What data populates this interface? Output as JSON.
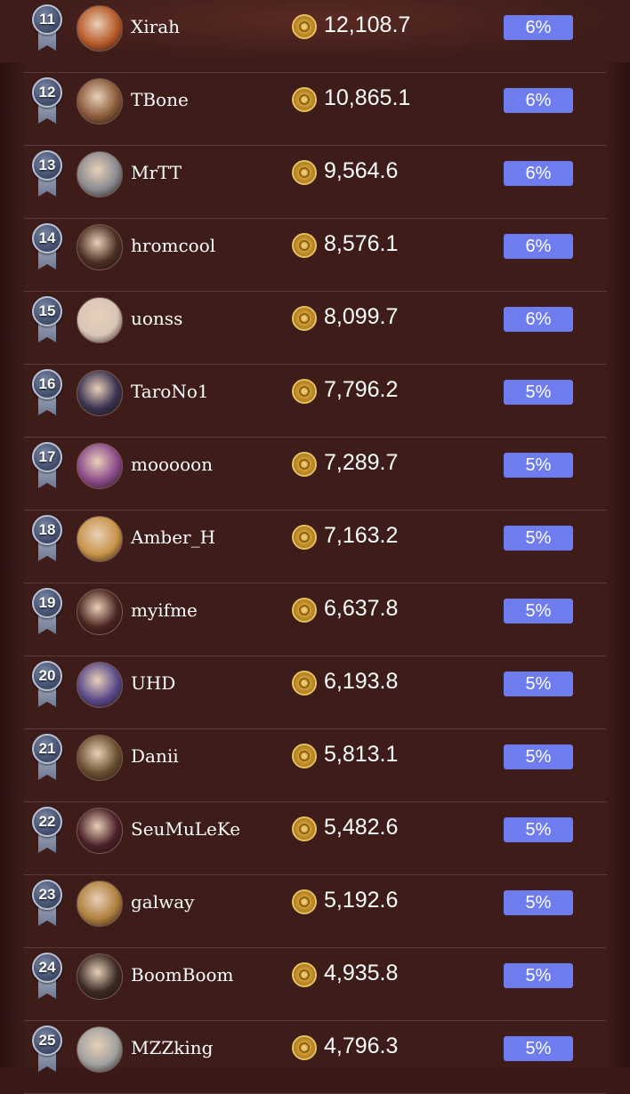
{
  "leaderboard": {
    "rows": [
      {
        "rank": "11",
        "name": "Xirah",
        "amount": "12,108.7",
        "percent": "6%",
        "avatar_color": "#b85a2a"
      },
      {
        "rank": "12",
        "name": "TBone",
        "amount": "10,865.1",
        "percent": "6%",
        "avatar_color": "#8a5a3a"
      },
      {
        "rank": "13",
        "name": "MrTT",
        "amount": "9,564.6",
        "percent": "6%",
        "avatar_color": "#8a8a90"
      },
      {
        "rank": "14",
        "name": "hromcool",
        "amount": "8,576.1",
        "percent": "6%",
        "avatar_color": "#4a2e24"
      },
      {
        "rank": "15",
        "name": "uonss",
        "amount": "8,099.7",
        "percent": "6%",
        "avatar_color": "#d8c6b8"
      },
      {
        "rank": "16",
        "name": "TaroNo1",
        "amount": "7,796.2",
        "percent": "5%",
        "avatar_color": "#3a3250"
      },
      {
        "rank": "17",
        "name": "mooooon",
        "amount": "7,289.7",
        "percent": "5%",
        "avatar_color": "#8a4a8a"
      },
      {
        "rank": "18",
        "name": "Amber_H",
        "amount": "7,163.2",
        "percent": "5%",
        "avatar_color": "#c8944a"
      },
      {
        "rank": "19",
        "name": "myifme",
        "amount": "6,637.8",
        "percent": "5%",
        "avatar_color": "#4a2420"
      },
      {
        "rank": "20",
        "name": "UHD",
        "amount": "6,193.8",
        "percent": "5%",
        "avatar_color": "#5a4a8a"
      },
      {
        "rank": "21",
        "name": "Danii",
        "amount": "5,813.1",
        "percent": "5%",
        "avatar_color": "#6a5030"
      },
      {
        "rank": "22",
        "name": "SeuMuLeKe",
        "amount": "5,482.6",
        "percent": "5%",
        "avatar_color": "#4a2028"
      },
      {
        "rank": "23",
        "name": "galway",
        "amount": "5,192.6",
        "percent": "5%",
        "avatar_color": "#b08040"
      },
      {
        "rank": "24",
        "name": "BoomBoom",
        "amount": "4,935.8",
        "percent": "5%",
        "avatar_color": "#3a2a24"
      },
      {
        "rank": "25",
        "name": "MZZking",
        "amount": "4,796.3",
        "percent": "5%",
        "avatar_color": "#a0a0a0"
      }
    ]
  },
  "colors": {
    "background": "#3d1c19",
    "percent_badge": "#6f7cf0",
    "coin": "#c9962e"
  }
}
